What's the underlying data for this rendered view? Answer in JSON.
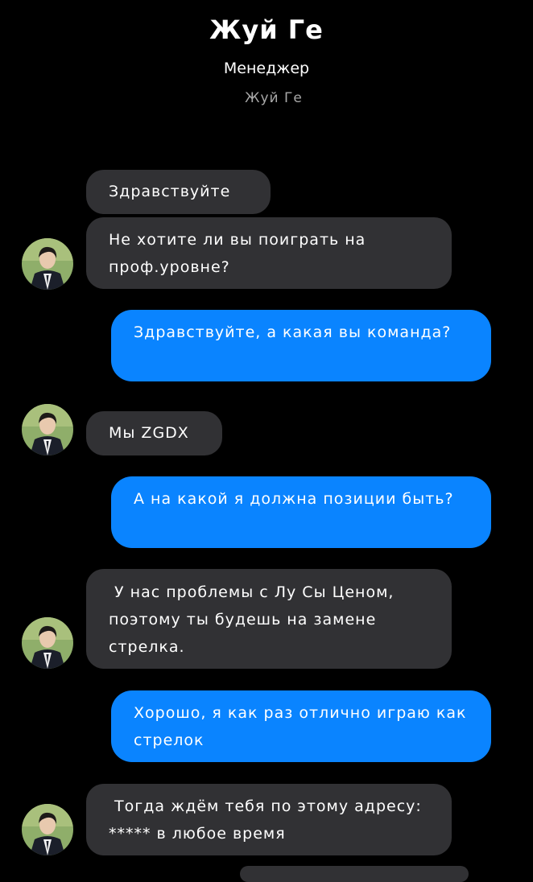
{
  "header": {
    "title": "Жуй Ге",
    "subtitle": "Менеджер",
    "subname": "Жуй Ге"
  },
  "colors": {
    "background": "#000000",
    "incoming_bubble": "#313134",
    "outgoing_bubble": "#0a84ff",
    "text": "#ffffff",
    "muted_text": "#a8a8a8"
  },
  "messages": [
    {
      "from": "in",
      "text": "Здравствуйте"
    },
    {
      "from": "in",
      "text": "Не хотите ли вы поиграть на проф.уровне?"
    },
    {
      "from": "out",
      "text": "Здравствуйте, а какая вы команда?"
    },
    {
      "from": "in",
      "text": "Мы ZGDX"
    },
    {
      "from": "out",
      "text": "А на какой я должна позиции быть?"
    },
    {
      "from": "in",
      "text": " У нас проблемы с Лу Сы Ценом, поэтому ты будешь на замене стрелка."
    },
    {
      "from": "out",
      "text": "Хорошо, я как раз отлично играю как стрелок"
    },
    {
      "from": "in",
      "text": " Тогда ждём тебя по этому адресу: ***** в любое время"
    }
  ],
  "avatar_icon": "user-avatar-photo"
}
